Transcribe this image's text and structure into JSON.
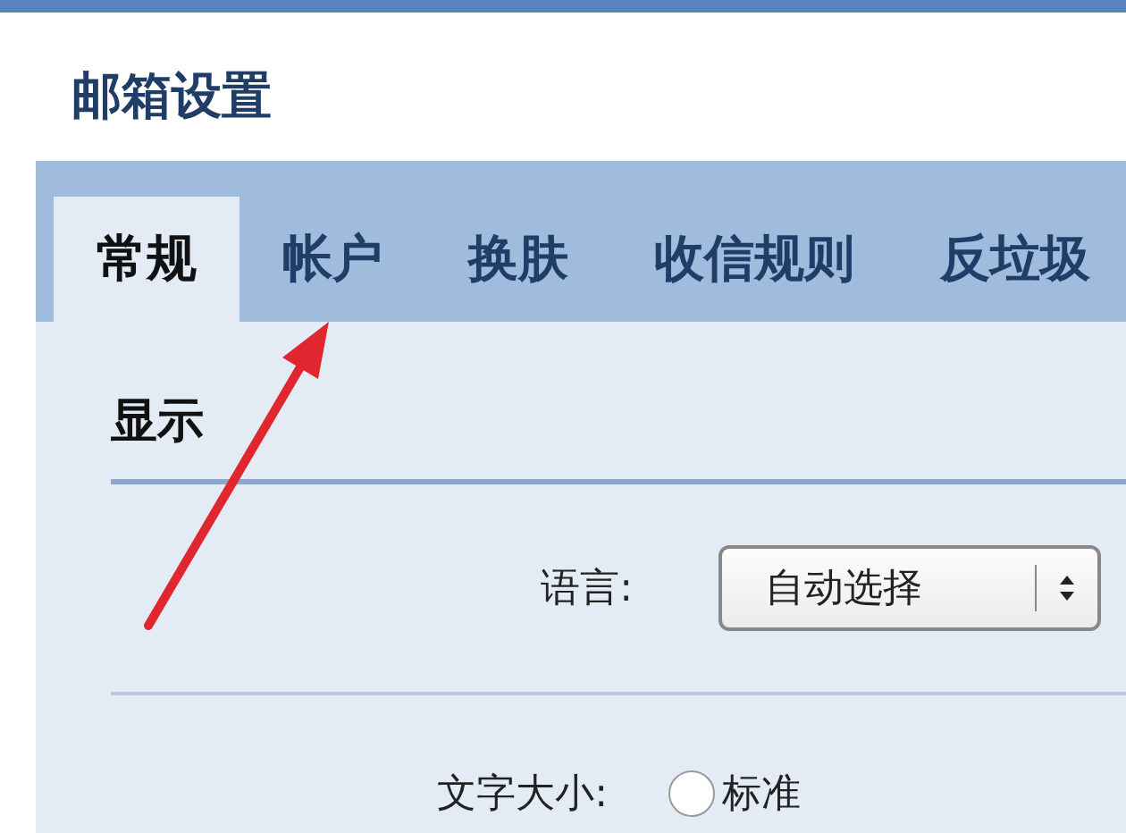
{
  "window": {
    "title": "邮箱设置"
  },
  "tabs": [
    {
      "label": "常规",
      "selected": true
    },
    {
      "label": "帐户",
      "selected": false
    },
    {
      "label": "换肤",
      "selected": false
    },
    {
      "label": "收信规则",
      "selected": false
    },
    {
      "label": "反垃圾",
      "selected": false
    }
  ],
  "section": {
    "title": "显示"
  },
  "settings": [
    {
      "kind": "select",
      "label": "语言:",
      "value": "自动选择"
    },
    {
      "kind": "radio",
      "label": "文字大小:",
      "options": [
        {
          "label": "标准",
          "selected": false
        }
      ]
    }
  ]
}
